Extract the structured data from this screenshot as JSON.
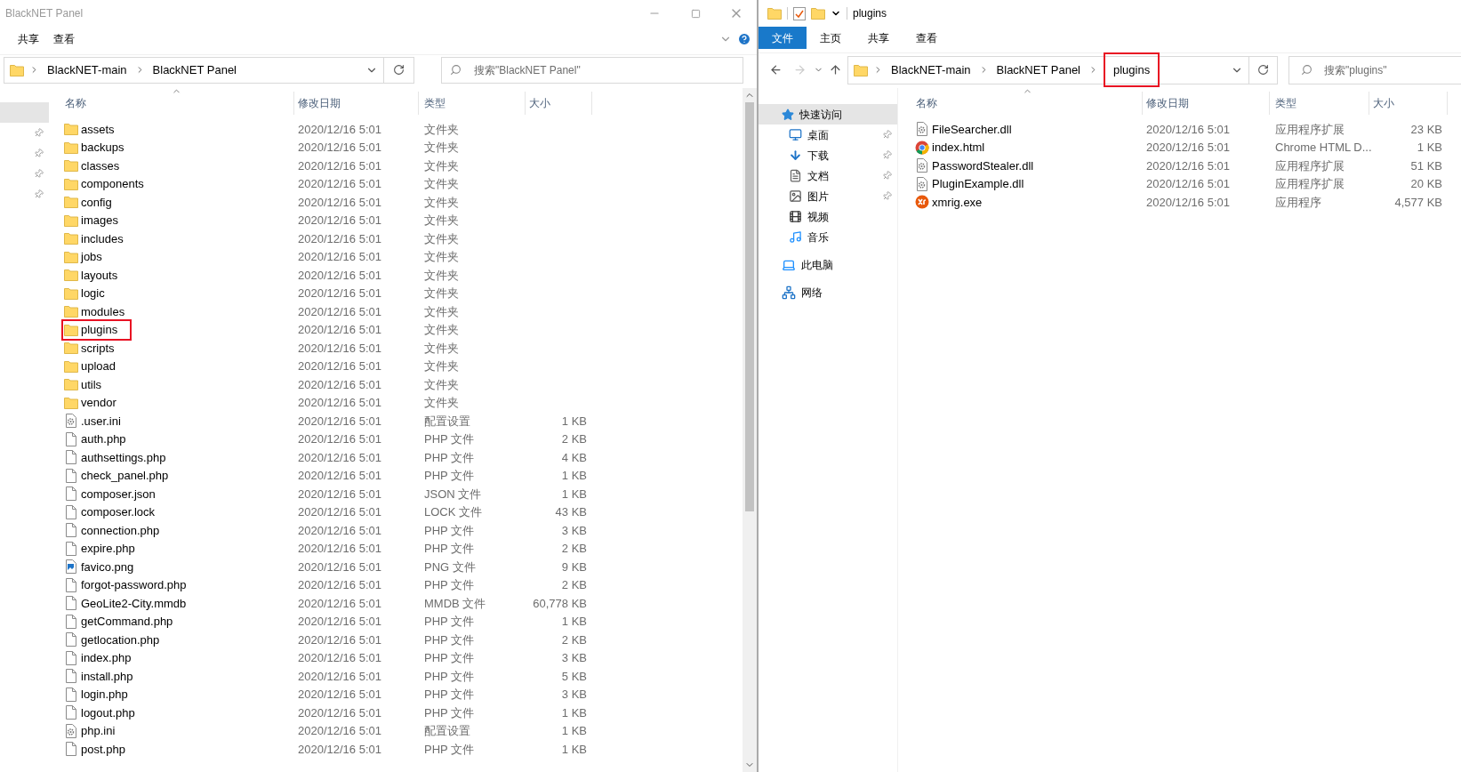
{
  "left_window": {
    "title": "BlackNET Panel",
    "ribbon_tabs": [
      {
        "label": "共享",
        "selected": false
      },
      {
        "label": "查看",
        "selected": false
      }
    ],
    "breadcrumb": [
      {
        "label": "BlackNET-main",
        "highlighted": false
      },
      {
        "label": "BlackNET Panel",
        "highlighted": false
      }
    ],
    "search": {
      "placeholder": "搜索\"BlackNET Panel\""
    },
    "nav_rows": [
      {
        "selected": true,
        "pinned": false
      },
      {
        "selected": false,
        "pinned": true
      },
      {
        "selected": false,
        "pinned": true
      },
      {
        "selected": false,
        "pinned": true
      },
      {
        "selected": false,
        "pinned": true
      }
    ],
    "columns": [
      "名称",
      "修改日期",
      "类型",
      "大小"
    ],
    "rows": [
      {
        "kind": "folder",
        "name": "assets",
        "date": "2020/12/16 5:01",
        "type": "文件夹",
        "size": "",
        "highlighted": false
      },
      {
        "kind": "folder",
        "name": "backups",
        "date": "2020/12/16 5:01",
        "type": "文件夹",
        "size": "",
        "highlighted": false
      },
      {
        "kind": "folder",
        "name": "classes",
        "date": "2020/12/16 5:01",
        "type": "文件夹",
        "size": "",
        "highlighted": false
      },
      {
        "kind": "folder",
        "name": "components",
        "date": "2020/12/16 5:01",
        "type": "文件夹",
        "size": "",
        "highlighted": false
      },
      {
        "kind": "folder",
        "name": "config",
        "date": "2020/12/16 5:01",
        "type": "文件夹",
        "size": "",
        "highlighted": false
      },
      {
        "kind": "folder",
        "name": "images",
        "date": "2020/12/16 5:01",
        "type": "文件夹",
        "size": "",
        "highlighted": false
      },
      {
        "kind": "folder",
        "name": "includes",
        "date": "2020/12/16 5:01",
        "type": "文件夹",
        "size": "",
        "highlighted": false
      },
      {
        "kind": "folder",
        "name": "jobs",
        "date": "2020/12/16 5:01",
        "type": "文件夹",
        "size": "",
        "highlighted": false
      },
      {
        "kind": "folder",
        "name": "layouts",
        "date": "2020/12/16 5:01",
        "type": "文件夹",
        "size": "",
        "highlighted": false
      },
      {
        "kind": "folder",
        "name": "logic",
        "date": "2020/12/16 5:01",
        "type": "文件夹",
        "size": "",
        "highlighted": false
      },
      {
        "kind": "folder",
        "name": "modules",
        "date": "2020/12/16 5:01",
        "type": "文件夹",
        "size": "",
        "highlighted": false
      },
      {
        "kind": "folder",
        "name": "plugins",
        "date": "2020/12/16 5:01",
        "type": "文件夹",
        "size": "",
        "highlighted": true
      },
      {
        "kind": "folder",
        "name": "scripts",
        "date": "2020/12/16 5:01",
        "type": "文件夹",
        "size": "",
        "highlighted": false
      },
      {
        "kind": "folder",
        "name": "upload",
        "date": "2020/12/16 5:01",
        "type": "文件夹",
        "size": "",
        "highlighted": false
      },
      {
        "kind": "folder",
        "name": "utils",
        "date": "2020/12/16 5:01",
        "type": "文件夹",
        "size": "",
        "highlighted": false
      },
      {
        "kind": "folder",
        "name": "vendor",
        "date": "2020/12/16 5:01",
        "type": "文件夹",
        "size": "",
        "highlighted": false
      },
      {
        "kind": "config",
        "name": ".user.ini",
        "date": "2020/12/16 5:01",
        "type": "配置设置",
        "size": "1 KB",
        "highlighted": false
      },
      {
        "kind": "file",
        "name": "auth.php",
        "date": "2020/12/16 5:01",
        "type": "PHP 文件",
        "size": "2 KB",
        "highlighted": false
      },
      {
        "kind": "file",
        "name": "authsettings.php",
        "date": "2020/12/16 5:01",
        "type": "PHP 文件",
        "size": "4 KB",
        "highlighted": false
      },
      {
        "kind": "file",
        "name": "check_panel.php",
        "date": "2020/12/16 5:01",
        "type": "PHP 文件",
        "size": "1 KB",
        "highlighted": false
      },
      {
        "kind": "file",
        "name": "composer.json",
        "date": "2020/12/16 5:01",
        "type": "JSON 文件",
        "size": "1 KB",
        "highlighted": false
      },
      {
        "kind": "file",
        "name": "composer.lock",
        "date": "2020/12/16 5:01",
        "type": "LOCK 文件",
        "size": "43 KB",
        "highlighted": false
      },
      {
        "kind": "file",
        "name": "connection.php",
        "date": "2020/12/16 5:01",
        "type": "PHP 文件",
        "size": "3 KB",
        "highlighted": false
      },
      {
        "kind": "file",
        "name": "expire.php",
        "date": "2020/12/16 5:01",
        "type": "PHP 文件",
        "size": "2 KB",
        "highlighted": false
      },
      {
        "kind": "image",
        "name": "favico.png",
        "date": "2020/12/16 5:01",
        "type": "PNG 文件",
        "size": "9 KB",
        "highlighted": false
      },
      {
        "kind": "file",
        "name": "forgot-password.php",
        "date": "2020/12/16 5:01",
        "type": "PHP 文件",
        "size": "2 KB",
        "highlighted": false
      },
      {
        "kind": "file",
        "name": "GeoLite2-City.mmdb",
        "date": "2020/12/16 5:01",
        "type": "MMDB 文件",
        "size": "60,778 KB",
        "highlighted": false
      },
      {
        "kind": "file",
        "name": "getCommand.php",
        "date": "2020/12/16 5:01",
        "type": "PHP 文件",
        "size": "1 KB",
        "highlighted": false
      },
      {
        "kind": "file",
        "name": "getlocation.php",
        "date": "2020/12/16 5:01",
        "type": "PHP 文件",
        "size": "2 KB",
        "highlighted": false
      },
      {
        "kind": "file",
        "name": "index.php",
        "date": "2020/12/16 5:01",
        "type": "PHP 文件",
        "size": "3 KB",
        "highlighted": false
      },
      {
        "kind": "file",
        "name": "install.php",
        "date": "2020/12/16 5:01",
        "type": "PHP 文件",
        "size": "5 KB",
        "highlighted": false
      },
      {
        "kind": "file",
        "name": "login.php",
        "date": "2020/12/16 5:01",
        "type": "PHP 文件",
        "size": "3 KB",
        "highlighted": false
      },
      {
        "kind": "file",
        "name": "logout.php",
        "date": "2020/12/16 5:01",
        "type": "PHP 文件",
        "size": "1 KB",
        "highlighted": false
      },
      {
        "kind": "config",
        "name": "php.ini",
        "date": "2020/12/16 5:01",
        "type": "配置设置",
        "size": "1 KB",
        "highlighted": false
      },
      {
        "kind": "file",
        "name": "post.php",
        "date": "2020/12/16 5:01",
        "type": "PHP 文件",
        "size": "1 KB",
        "highlighted": false
      }
    ]
  },
  "right_window": {
    "title": "plugins",
    "ribbon_tabs": [
      {
        "label": "文件",
        "selected": true
      },
      {
        "label": "主页",
        "selected": false
      },
      {
        "label": "共享",
        "selected": false
      },
      {
        "label": "查看",
        "selected": false
      }
    ],
    "breadcrumb": [
      {
        "label": "BlackNET-main",
        "highlighted": false
      },
      {
        "label": "BlackNET Panel",
        "highlighted": false
      },
      {
        "label": "plugins",
        "highlighted": true
      }
    ],
    "search": {
      "placeholder": "搜索\"plugins\""
    },
    "nav_items": [
      {
        "label": "快速访问",
        "selected": true,
        "children": [
          {
            "label": "桌面",
            "selected": false,
            "pinned": true
          },
          {
            "label": "下载",
            "selected": false,
            "pinned": true
          },
          {
            "label": "文档",
            "selected": false,
            "pinned": true
          },
          {
            "label": "图片",
            "selected": false,
            "pinned": true
          },
          {
            "label": "视频",
            "selected": false,
            "pinned": false
          },
          {
            "label": "音乐",
            "selected": false,
            "pinned": false
          }
        ]
      },
      {
        "label": "此电脑",
        "selected": false
      },
      {
        "label": "网络",
        "selected": false
      }
    ],
    "columns": [
      "名称",
      "修改日期",
      "类型",
      "大小"
    ],
    "rows": [
      {
        "kind": "library",
        "name": "FileSearcher.dll",
        "date": "2020/12/16 5:01",
        "type": "应用程序扩展",
        "size": "23 KB"
      },
      {
        "kind": "webpage",
        "name": "index.html",
        "date": "2020/12/16 5:01",
        "type": "Chrome HTML D...",
        "size": "1 KB"
      },
      {
        "kind": "library",
        "name": "PasswordStealer.dll",
        "date": "2020/12/16 5:01",
        "type": "应用程序扩展",
        "size": "51 KB"
      },
      {
        "kind": "library",
        "name": "PluginExample.dll",
        "date": "2020/12/16 5:01",
        "type": "应用程序扩展",
        "size": "20 KB"
      },
      {
        "kind": "program",
        "name": "xmrig.exe",
        "date": "2020/12/16 5:01",
        "type": "应用程序",
        "size": "4,577 KB"
      }
    ]
  }
}
